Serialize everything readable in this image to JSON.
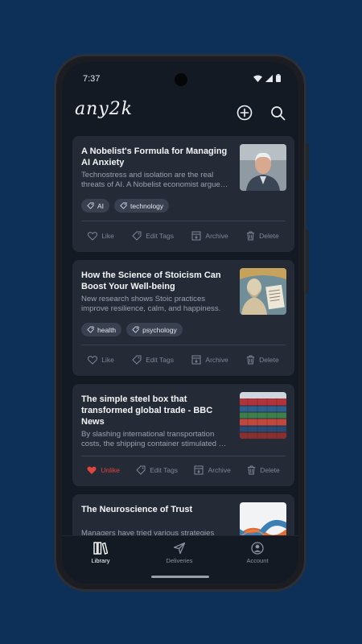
{
  "status": {
    "time": "7:37"
  },
  "app": {
    "logo": "any2k"
  },
  "articles": [
    {
      "title": "A Nobelist's Formula for Managing AI Anxiety",
      "description": "Technostress and isolation are the real threats of AI. A Nobelist economist argue…",
      "tags": [
        "AI",
        "technology"
      ],
      "liked": false,
      "actions": {
        "like": "Like",
        "edit": "Edit Tags",
        "archive": "Archive",
        "delete": "Delete"
      }
    },
    {
      "title": "How the Science of Stoicism Can Boost Your Well-being",
      "description": "New research shows Stoic practices improve resilience, calm, and happiness.",
      "tags": [
        "health",
        "psychology"
      ],
      "liked": false,
      "actions": {
        "like": "Like",
        "edit": "Edit Tags",
        "archive": "Archive",
        "delete": "Delete"
      }
    },
    {
      "title": "The simple steel box that transformed global trade - BBC News",
      "description": "By slashing international transportation costs, the shipping container stimulated …",
      "tags": [],
      "liked": true,
      "actions": {
        "like": "Unlike",
        "edit": "Edit Tags",
        "archive": "Archive",
        "delete": "Delete"
      }
    },
    {
      "title": "The Neuroscience of Trust",
      "description": "Managers have tried various strategies",
      "tags": [],
      "liked": false
    }
  ],
  "nav": {
    "library": "Library",
    "deliveries": "Deliveries",
    "account": "Account",
    "active": "library"
  },
  "colors": {
    "background": "#0c3057",
    "card": "#242a36",
    "liked": "#e0453f",
    "screen": "#141a24"
  }
}
